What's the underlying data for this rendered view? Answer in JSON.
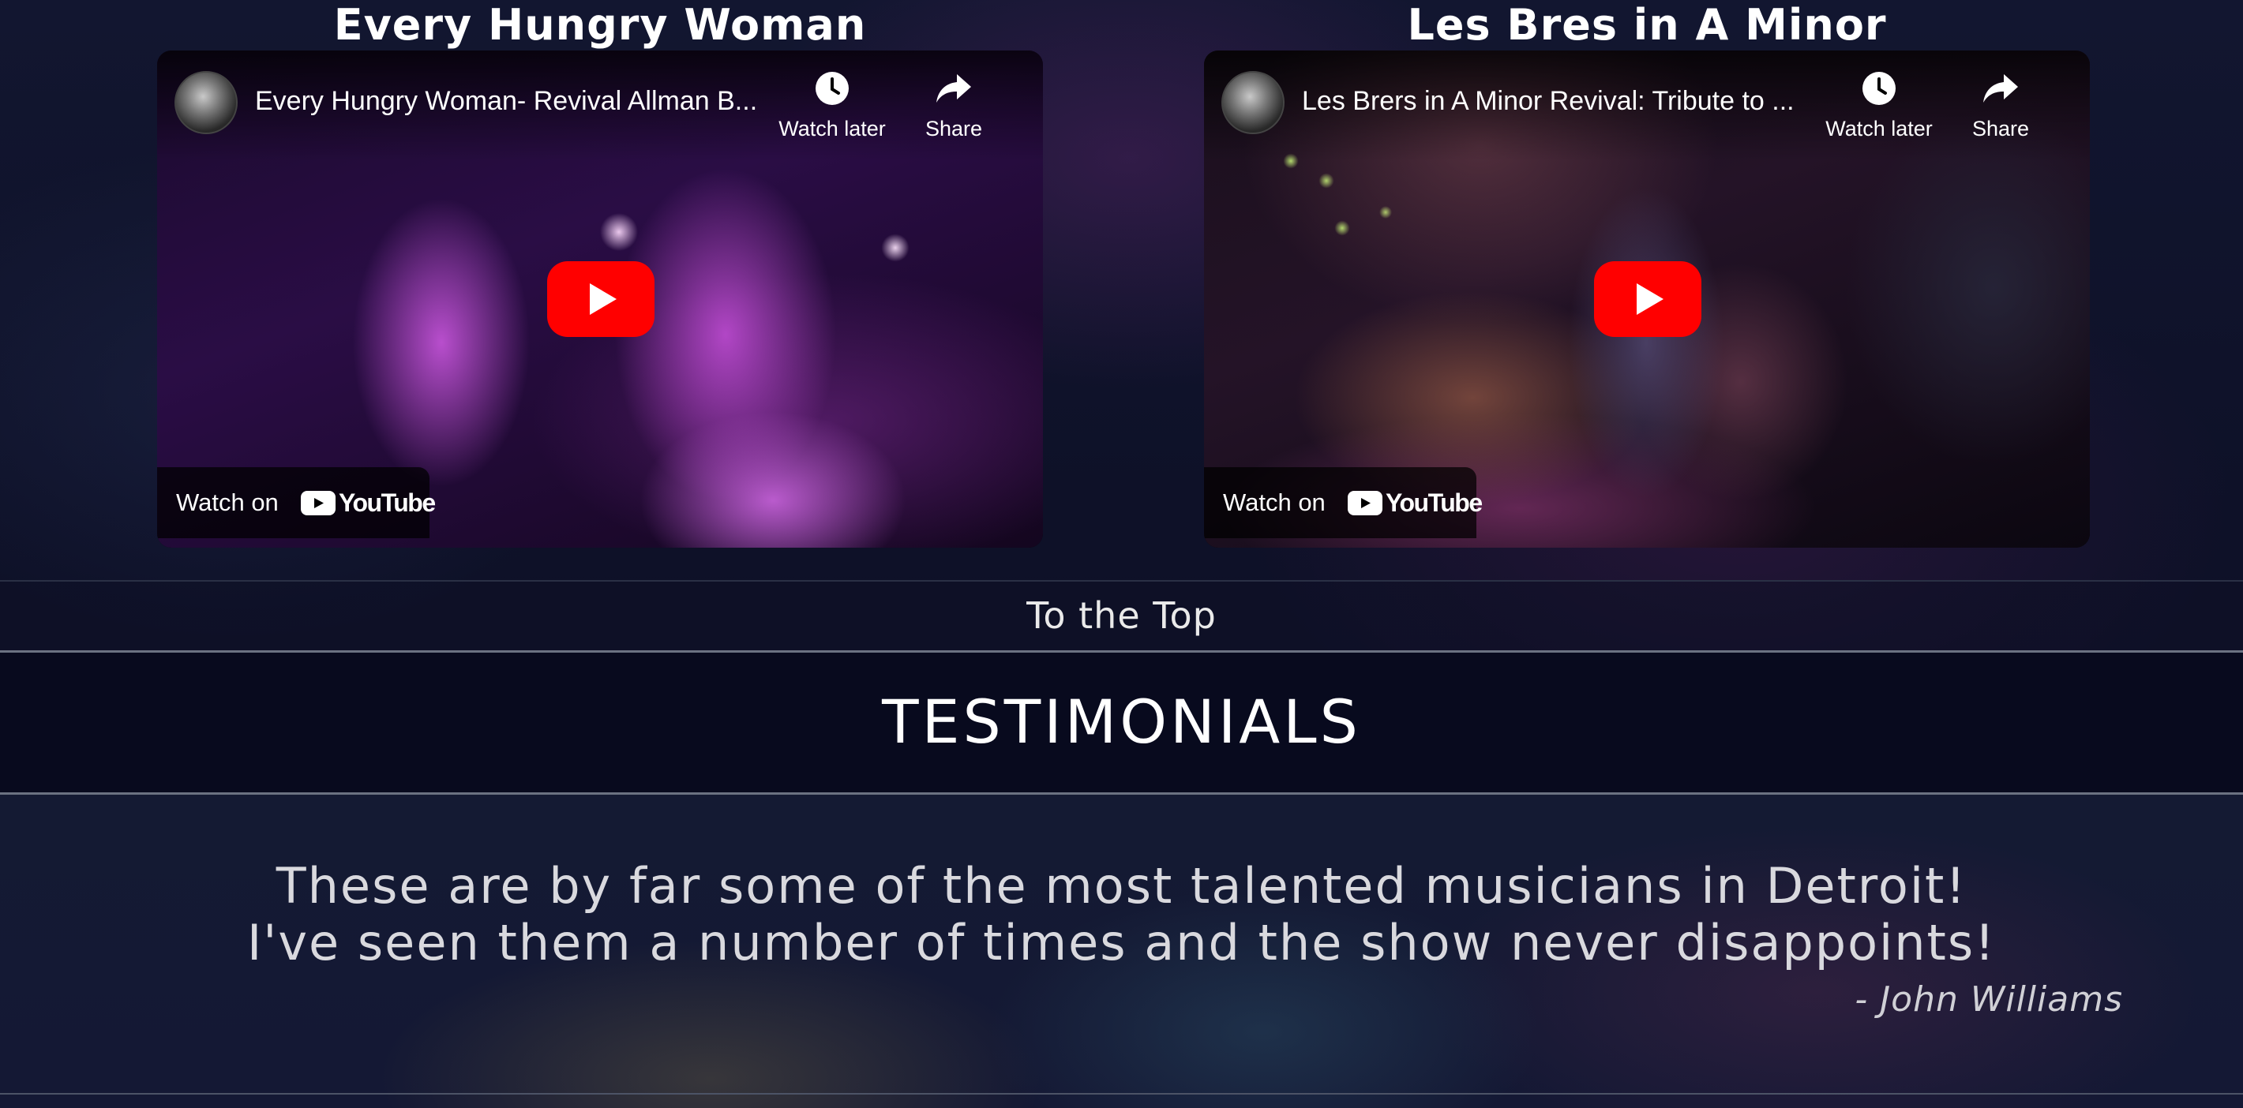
{
  "videos": [
    {
      "section_title": "Every Hungry Woman",
      "video_title": "Every Hungry Woman- Revival Allman B...",
      "watch_later": "Watch later",
      "share": "Share",
      "watch_on": "Watch on",
      "youtube": "YouTube"
    },
    {
      "section_title": "Les Bres in A Minor",
      "video_title": "Les Brers in A Minor Revival: Tribute to ...",
      "watch_later": "Watch later",
      "share": "Share",
      "watch_on": "Watch on",
      "youtube": "YouTube"
    }
  ],
  "nav": {
    "to_top": "To the Top"
  },
  "testimonials": {
    "heading": "TESTIMONIALS",
    "quote_line_1": "These are by far some of the most talented musicians in Detroit!",
    "quote_line_2": "I've seen them a number of times and the show never disappoints!",
    "author": "- John Williams"
  },
  "colors": {
    "youtube_red": "#ff0000",
    "page_background": "#0d1027",
    "header_band": "#080a1e",
    "divider": "#6b7282"
  }
}
